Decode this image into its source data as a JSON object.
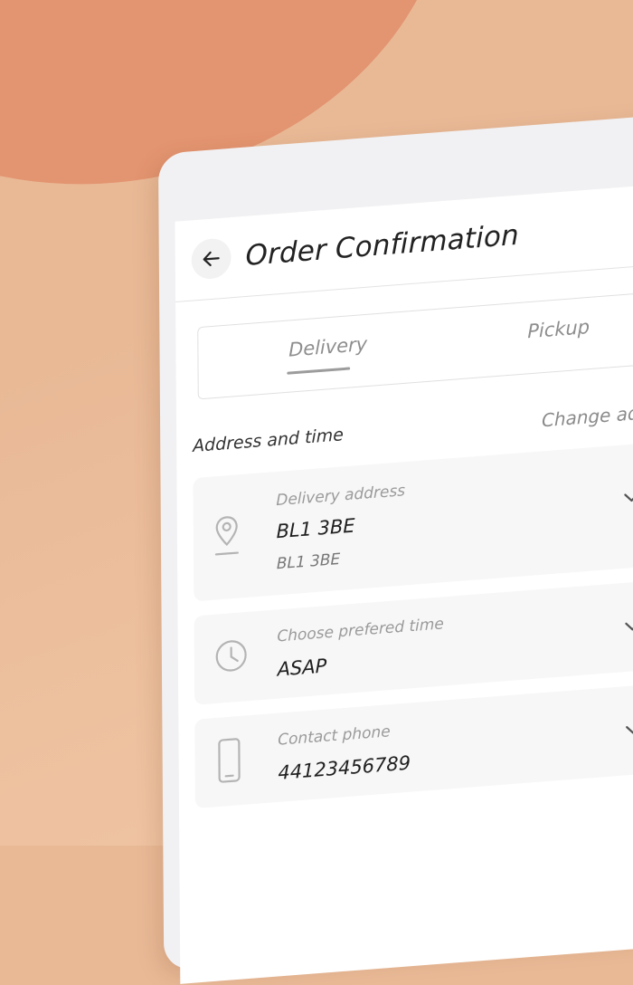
{
  "header": {
    "title": "Order Confirmation"
  },
  "tabs": [
    {
      "label": "Delivery",
      "active": true
    },
    {
      "label": "Pickup",
      "active": false
    }
  ],
  "section": {
    "label": "Address and time",
    "change_link": "Change address"
  },
  "cards": {
    "address": {
      "label": "Delivery address",
      "value": "BL1 3BE",
      "sub": "BL1 3BE",
      "icon": "location-pin-icon"
    },
    "time": {
      "label": "Choose prefered time",
      "value": "ASAP",
      "icon": "clock-icon"
    },
    "phone": {
      "label": "Contact phone",
      "value": "44123456789",
      "icon": "phone-icon"
    }
  },
  "colors": {
    "background": "#e9b996",
    "blob": "#e39470",
    "device": "#f1f1f3",
    "card": "#f7f7f7"
  }
}
